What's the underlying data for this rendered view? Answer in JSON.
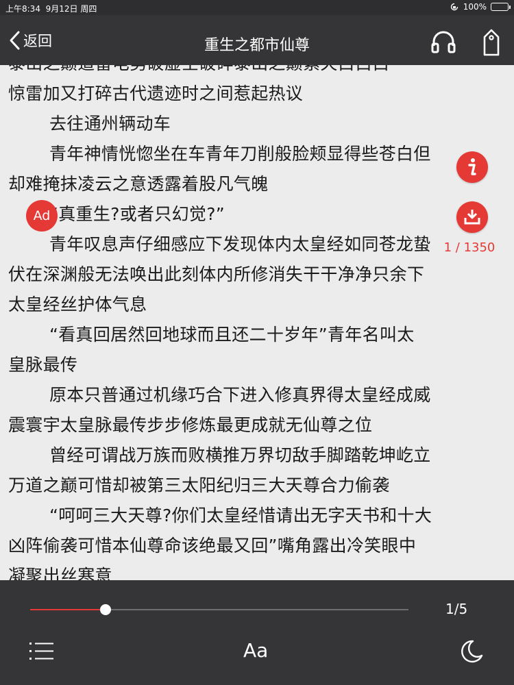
{
  "status_bar": {
    "time": "上午8:34",
    "date": "9月12日 周四",
    "battery": "100%",
    "battery_level": 1.0
  },
  "nav": {
    "back_label": "返回",
    "title": "重生之都市仙尊",
    "icons": [
      "chevron-left-icon",
      "headphones-icon",
      "bookmark-tag-icon"
    ]
  },
  "content": {
    "lines": [
      {
        "text": "泰山之巅道雷电劈破虚空破碎泰山之巅紫天白白白",
        "indent": false
      },
      {
        "text": "惊雷加又打碎古代遗迹时之间惹起热议",
        "indent": false
      },
      {
        "text": "去往通州辆动车",
        "indent": true
      },
      {
        "text": "青年神情恍惚坐在车青年刀削般脸颊显得些苍白但",
        "indent": true
      },
      {
        "text": "却难掩抹凌云之意透露着股凡气魄",
        "indent": false
      },
      {
        "text": "“真重生?或者只幻觉?”",
        "indent": true
      },
      {
        "text": "青年叹息声仔细感应下发现体内太皇经如同苍龙蛰",
        "indent": true
      },
      {
        "text": "伏在深渊般无法唤出此刻体内所修消失干干净净只余下",
        "indent": false
      },
      {
        "text": "太皇经丝护体气息",
        "indent": false
      },
      {
        "text": "“看真回居然回地球而且还二十岁年”青年名叫太",
        "indent": true
      },
      {
        "text": "皇脉最传",
        "indent": false
      },
      {
        "text": "原本只普通过机缘巧合下进入修真界得太皇经成威",
        "indent": true
      },
      {
        "text": "震寰宇太皇脉最传步步修炼最更成就无仙尊之位",
        "indent": false
      },
      {
        "text": "曾经可谓战万族而败横推万界切敌手脚踏乾坤屹立",
        "indent": true
      },
      {
        "text": "万道之巅可惜却被第三太阳纪归三大天尊合力偷袭",
        "indent": false
      },
      {
        "text": "“呵呵三大天尊?你们太皇经惜请出无字天书和十大",
        "indent": true
      },
      {
        "text": "凶阵偷袭可惜本仙尊命该绝最又回”嘴角露出冷笑眼中",
        "indent": false
      },
      {
        "text": "凝聚出丝寒意",
        "indent": false
      }
    ],
    "ad_label": "Ad",
    "page_count": "1 / 1350"
  },
  "bottom_bar": {
    "progress_label": "1/5",
    "progress_fraction": 0.2,
    "font_label": "Aa",
    "icons": [
      "toc-list-icon",
      "font-size-icon",
      "night-mode-moon-icon"
    ]
  },
  "colors": {
    "accent": "#e53935",
    "bar_bg": "#353537",
    "page_bg": "#ececec",
    "text": "#1a1a1a"
  }
}
